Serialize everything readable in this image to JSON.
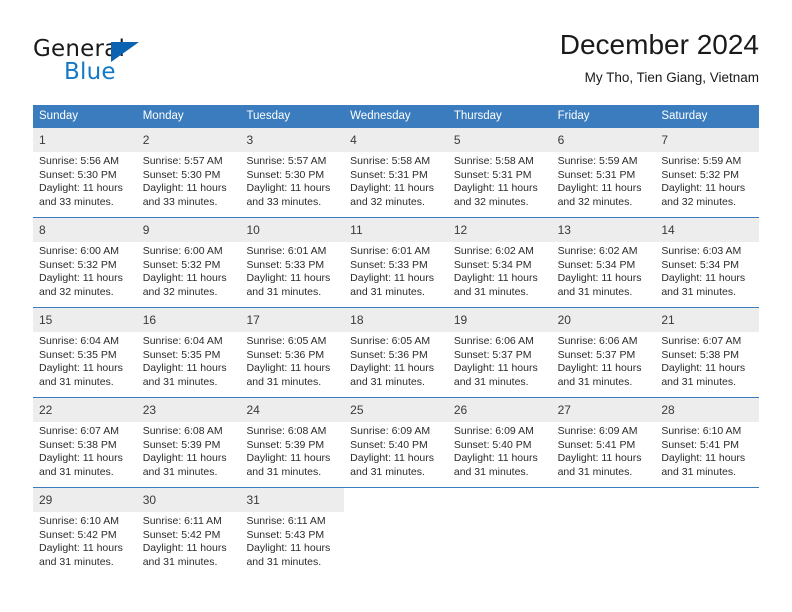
{
  "brand": {
    "name_top": "General",
    "name_bottom": "Blue",
    "accent_color": "#0b62b0",
    "blue_text_color": "#1278c8"
  },
  "header": {
    "title": "December 2024",
    "subtitle": "My Tho, Tien Giang, Vietnam"
  },
  "calendar": {
    "header_color": "#3a7cbe",
    "daynum_bar_color": "#ededed",
    "weekdays": [
      "Sunday",
      "Monday",
      "Tuesday",
      "Wednesday",
      "Thursday",
      "Friday",
      "Saturday"
    ],
    "weeks": [
      [
        {
          "day": "1",
          "sunrise": "Sunrise: 5:56 AM",
          "sunset": "Sunset: 5:30 PM",
          "daylight1": "Daylight: 11 hours",
          "daylight2": "and 33 minutes."
        },
        {
          "day": "2",
          "sunrise": "Sunrise: 5:57 AM",
          "sunset": "Sunset: 5:30 PM",
          "daylight1": "Daylight: 11 hours",
          "daylight2": "and 33 minutes."
        },
        {
          "day": "3",
          "sunrise": "Sunrise: 5:57 AM",
          "sunset": "Sunset: 5:30 PM",
          "daylight1": "Daylight: 11 hours",
          "daylight2": "and 33 minutes."
        },
        {
          "day": "4",
          "sunrise": "Sunrise: 5:58 AM",
          "sunset": "Sunset: 5:31 PM",
          "daylight1": "Daylight: 11 hours",
          "daylight2": "and 32 minutes."
        },
        {
          "day": "5",
          "sunrise": "Sunrise: 5:58 AM",
          "sunset": "Sunset: 5:31 PM",
          "daylight1": "Daylight: 11 hours",
          "daylight2": "and 32 minutes."
        },
        {
          "day": "6",
          "sunrise": "Sunrise: 5:59 AM",
          "sunset": "Sunset: 5:31 PM",
          "daylight1": "Daylight: 11 hours",
          "daylight2": "and 32 minutes."
        },
        {
          "day": "7",
          "sunrise": "Sunrise: 5:59 AM",
          "sunset": "Sunset: 5:32 PM",
          "daylight1": "Daylight: 11 hours",
          "daylight2": "and 32 minutes."
        }
      ],
      [
        {
          "day": "8",
          "sunrise": "Sunrise: 6:00 AM",
          "sunset": "Sunset: 5:32 PM",
          "daylight1": "Daylight: 11 hours",
          "daylight2": "and 32 minutes."
        },
        {
          "day": "9",
          "sunrise": "Sunrise: 6:00 AM",
          "sunset": "Sunset: 5:32 PM",
          "daylight1": "Daylight: 11 hours",
          "daylight2": "and 32 minutes."
        },
        {
          "day": "10",
          "sunrise": "Sunrise: 6:01 AM",
          "sunset": "Sunset: 5:33 PM",
          "daylight1": "Daylight: 11 hours",
          "daylight2": "and 31 minutes."
        },
        {
          "day": "11",
          "sunrise": "Sunrise: 6:01 AM",
          "sunset": "Sunset: 5:33 PM",
          "daylight1": "Daylight: 11 hours",
          "daylight2": "and 31 minutes."
        },
        {
          "day": "12",
          "sunrise": "Sunrise: 6:02 AM",
          "sunset": "Sunset: 5:34 PM",
          "daylight1": "Daylight: 11 hours",
          "daylight2": "and 31 minutes."
        },
        {
          "day": "13",
          "sunrise": "Sunrise: 6:02 AM",
          "sunset": "Sunset: 5:34 PM",
          "daylight1": "Daylight: 11 hours",
          "daylight2": "and 31 minutes."
        },
        {
          "day": "14",
          "sunrise": "Sunrise: 6:03 AM",
          "sunset": "Sunset: 5:34 PM",
          "daylight1": "Daylight: 11 hours",
          "daylight2": "and 31 minutes."
        }
      ],
      [
        {
          "day": "15",
          "sunrise": "Sunrise: 6:04 AM",
          "sunset": "Sunset: 5:35 PM",
          "daylight1": "Daylight: 11 hours",
          "daylight2": "and 31 minutes."
        },
        {
          "day": "16",
          "sunrise": "Sunrise: 6:04 AM",
          "sunset": "Sunset: 5:35 PM",
          "daylight1": "Daylight: 11 hours",
          "daylight2": "and 31 minutes."
        },
        {
          "day": "17",
          "sunrise": "Sunrise: 6:05 AM",
          "sunset": "Sunset: 5:36 PM",
          "daylight1": "Daylight: 11 hours",
          "daylight2": "and 31 minutes."
        },
        {
          "day": "18",
          "sunrise": "Sunrise: 6:05 AM",
          "sunset": "Sunset: 5:36 PM",
          "daylight1": "Daylight: 11 hours",
          "daylight2": "and 31 minutes."
        },
        {
          "day": "19",
          "sunrise": "Sunrise: 6:06 AM",
          "sunset": "Sunset: 5:37 PM",
          "daylight1": "Daylight: 11 hours",
          "daylight2": "and 31 minutes."
        },
        {
          "day": "20",
          "sunrise": "Sunrise: 6:06 AM",
          "sunset": "Sunset: 5:37 PM",
          "daylight1": "Daylight: 11 hours",
          "daylight2": "and 31 minutes."
        },
        {
          "day": "21",
          "sunrise": "Sunrise: 6:07 AM",
          "sunset": "Sunset: 5:38 PM",
          "daylight1": "Daylight: 11 hours",
          "daylight2": "and 31 minutes."
        }
      ],
      [
        {
          "day": "22",
          "sunrise": "Sunrise: 6:07 AM",
          "sunset": "Sunset: 5:38 PM",
          "daylight1": "Daylight: 11 hours",
          "daylight2": "and 31 minutes."
        },
        {
          "day": "23",
          "sunrise": "Sunrise: 6:08 AM",
          "sunset": "Sunset: 5:39 PM",
          "daylight1": "Daylight: 11 hours",
          "daylight2": "and 31 minutes."
        },
        {
          "day": "24",
          "sunrise": "Sunrise: 6:08 AM",
          "sunset": "Sunset: 5:39 PM",
          "daylight1": "Daylight: 11 hours",
          "daylight2": "and 31 minutes."
        },
        {
          "day": "25",
          "sunrise": "Sunrise: 6:09 AM",
          "sunset": "Sunset: 5:40 PM",
          "daylight1": "Daylight: 11 hours",
          "daylight2": "and 31 minutes."
        },
        {
          "day": "26",
          "sunrise": "Sunrise: 6:09 AM",
          "sunset": "Sunset: 5:40 PM",
          "daylight1": "Daylight: 11 hours",
          "daylight2": "and 31 minutes."
        },
        {
          "day": "27",
          "sunrise": "Sunrise: 6:09 AM",
          "sunset": "Sunset: 5:41 PM",
          "daylight1": "Daylight: 11 hours",
          "daylight2": "and 31 minutes."
        },
        {
          "day": "28",
          "sunrise": "Sunrise: 6:10 AM",
          "sunset": "Sunset: 5:41 PM",
          "daylight1": "Daylight: 11 hours",
          "daylight2": "and 31 minutes."
        }
      ],
      [
        {
          "day": "29",
          "sunrise": "Sunrise: 6:10 AM",
          "sunset": "Sunset: 5:42 PM",
          "daylight1": "Daylight: 11 hours",
          "daylight2": "and 31 minutes."
        },
        {
          "day": "30",
          "sunrise": "Sunrise: 6:11 AM",
          "sunset": "Sunset: 5:42 PM",
          "daylight1": "Daylight: 11 hours",
          "daylight2": "and 31 minutes."
        },
        {
          "day": "31",
          "sunrise": "Sunrise: 6:11 AM",
          "sunset": "Sunset: 5:43 PM",
          "daylight1": "Daylight: 11 hours",
          "daylight2": "and 31 minutes."
        },
        {
          "day": "",
          "sunrise": "",
          "sunset": "",
          "daylight1": "",
          "daylight2": ""
        },
        {
          "day": "",
          "sunrise": "",
          "sunset": "",
          "daylight1": "",
          "daylight2": ""
        },
        {
          "day": "",
          "sunrise": "",
          "sunset": "",
          "daylight1": "",
          "daylight2": ""
        },
        {
          "day": "",
          "sunrise": "",
          "sunset": "",
          "daylight1": "",
          "daylight2": ""
        }
      ]
    ]
  }
}
